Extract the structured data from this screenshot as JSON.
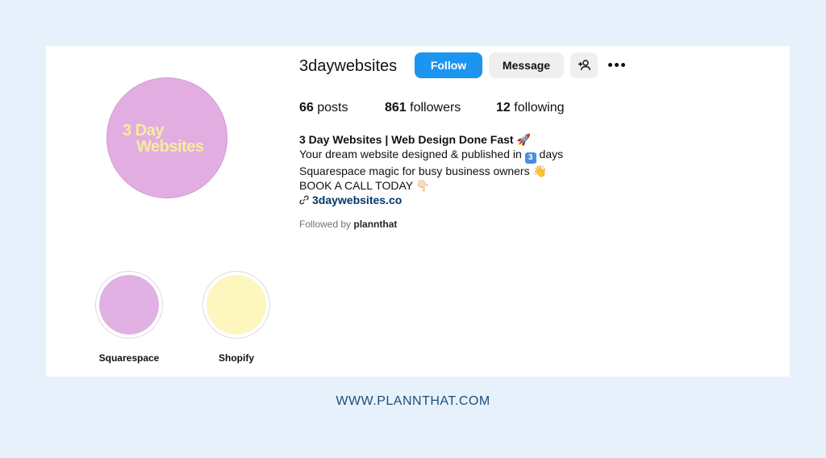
{
  "profile": {
    "avatar_text_line1": "3 Day",
    "avatar_text_line2": "Websites",
    "username": "3daywebsites"
  },
  "actions": {
    "follow_label": "Follow",
    "message_label": "Message",
    "add_user_icon": "person-add-icon",
    "more_icon": "more-horizontal-icon"
  },
  "stats": {
    "posts_count": "66",
    "posts_label": "posts",
    "followers_count": "861",
    "followers_label": "followers",
    "following_count": "12",
    "following_label": "following"
  },
  "bio": {
    "name": "3 Day Websites | Web Design Done Fast 🚀",
    "line1_before": "Your dream website designed & published in ",
    "line1_keycap": "3",
    "line1_after": " days",
    "line2": "Squarespace magic for busy business owners 👋",
    "line3": "BOOK A CALL TODAY 👇🏻",
    "link": "3daywebsites.co"
  },
  "followed_by": {
    "prefix": "Followed by",
    "user": "plannthat"
  },
  "highlights": [
    {
      "label": "Squarespace",
      "color": "#e0b1e2"
    },
    {
      "label": "Shopify",
      "color": "#fdf6be"
    }
  ],
  "footer": "WWW.PLANNTHAT.COM",
  "colors": {
    "follow_button": "#1b95f0",
    "avatar_bg": "#e2aee2",
    "avatar_text": "#f6ec9c",
    "page_bg": "#e6f1fb",
    "link": "#00376b"
  }
}
